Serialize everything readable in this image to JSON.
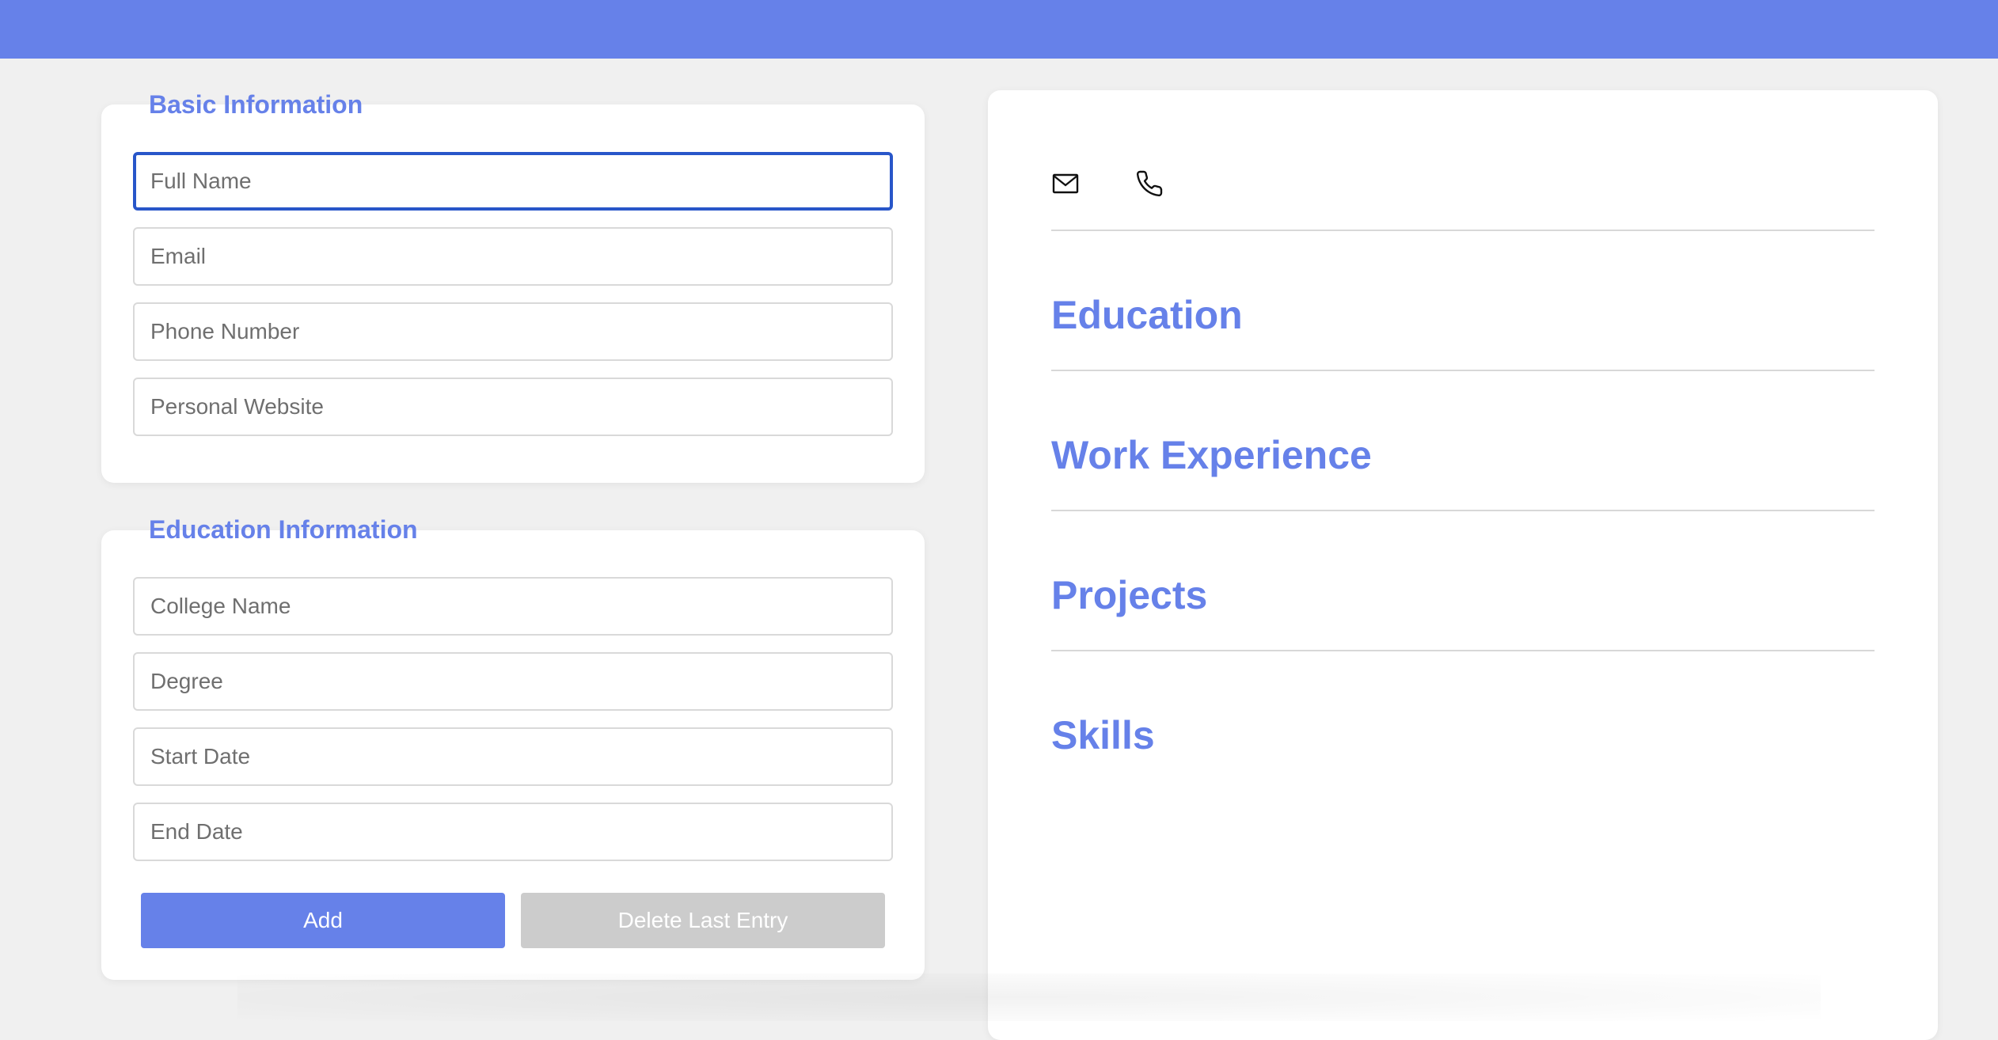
{
  "colors": {
    "accent": "#6681e9",
    "focus_border": "#2856c9",
    "disabled_button": "#cccccc",
    "background": "#f0f0f0"
  },
  "basic_info": {
    "title": "Basic Information",
    "full_name_placeholder": "Full Name",
    "email_placeholder": "Email",
    "phone_placeholder": "Phone Number",
    "website_placeholder": "Personal Website"
  },
  "education_info": {
    "title": "Education Information",
    "college_placeholder": "College Name",
    "degree_placeholder": "Degree",
    "start_date_placeholder": "Start Date",
    "end_date_placeholder": "End Date",
    "add_label": "Add",
    "delete_label": "Delete Last Entry"
  },
  "preview": {
    "icons": [
      "mail-icon",
      "phone-icon"
    ],
    "sections": {
      "education": "Education",
      "work": "Work Experience",
      "projects": "Projects",
      "skills": "Skills"
    }
  }
}
